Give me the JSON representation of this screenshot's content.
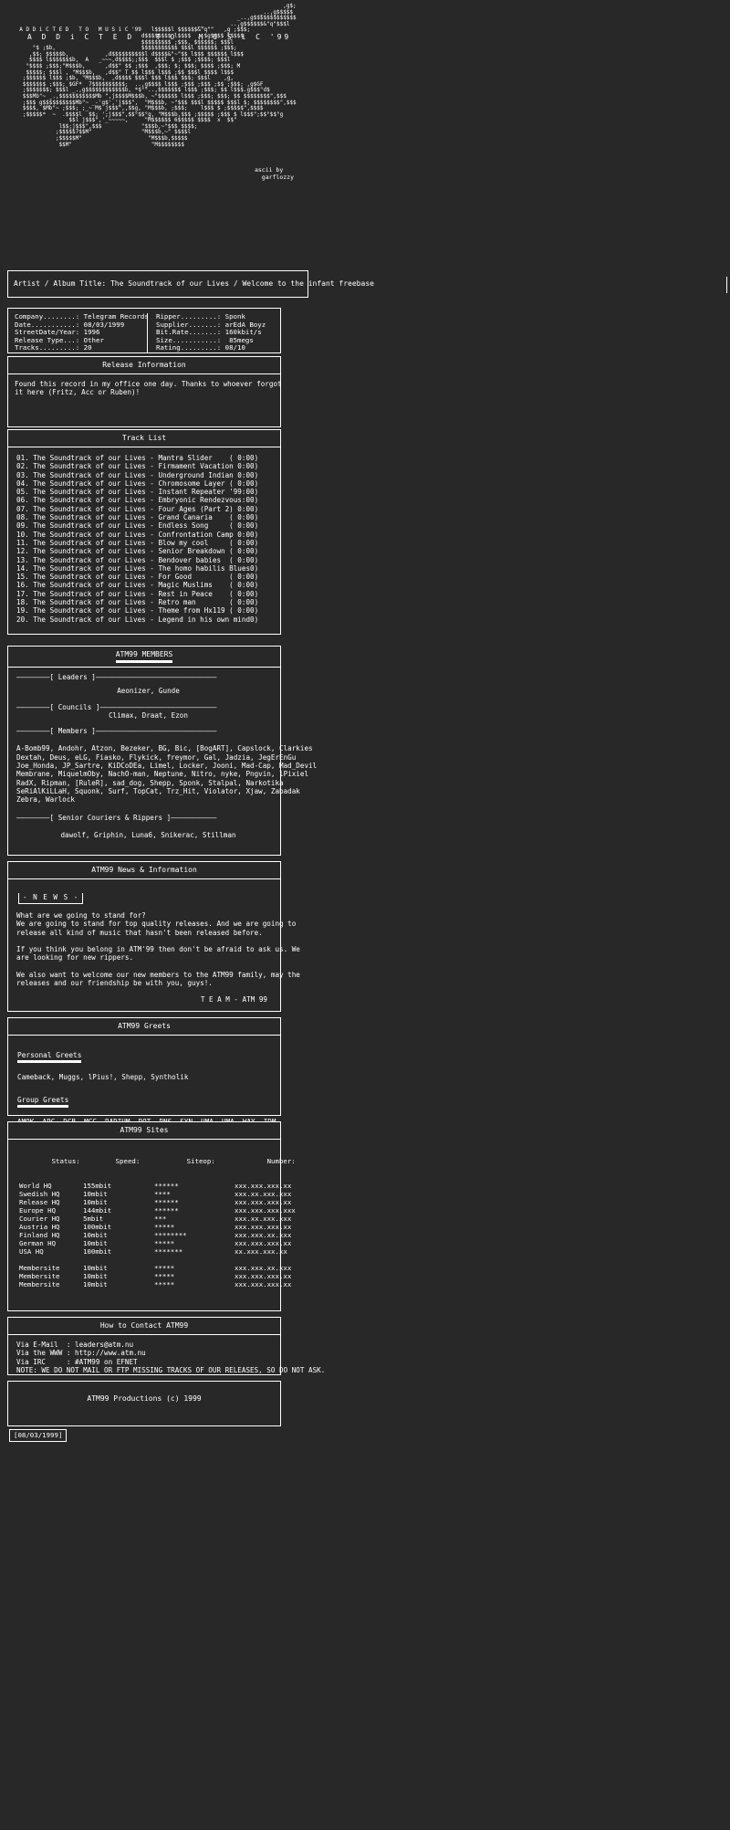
{
  "logo": {
    "ascii": "                                                                                  ,g$;\n                                                                           _..,g$$$$$\n                                                                    _..,g$$$$$$$$$$$$$\n                                                        __        ..,g$$$$$$&\"q\"$$$l\n  A D D i C T E D   T O   M U S i C '99   l$$$$$l $$$$$$&\"q\"\"   ,g ;$$$;\n                                       d$$$$$$$$ l$$$$  ,,$g$$$$ l$$$$\n                                       $$$$$$$$$ ;$$$, $$$$$$; $$$l\n      °$ ;$b,                          $$$$$$$$$$$ $$$l $$$$$$ ;$$$;\n     ,$$; $$$$$b,           ,d$$$$$$$$$$l d$$$$&\"~\"$$ l$$$ $$$$$$ l$$$\n     $$$$ l$$$$$$$b,  A   _~~~,d$$$$;;$$$  $$$l $ ;$$$ ;$$$$; $$$l\n    °$$$$ ;$$$;\"M$$$b,      ,d$$\" $$ ;$$$  ,$$$; $; $$$; $$$$ ;$$$; M\n    $$$$$; $$$l , \"M$$$b,   ,d$$\" T $$ l$$$ l$$$ ;$$ $$$l $$$$ l$$$\n   ;$$$$$$ l$$$ ;$b, \"M$$$b,  ,d$$$$ $$$l $$$ l$$$ $$$; $$$l    ,g,\n   $$$$$$$ ;$$$; $GF*  7$$$$$$$$$$;  ..,g$$$$ l$$$ ;$$$ ;$$$ ;$$ ;$$$; ,g$GF\n   ;$$$$$$$; $$$l _.,g$$$$$$$$$$$$b, *$°°..,$$$$$$$ l$$$ ;$$$; $$ l$$$.g$$$\"d$\n   $$$Mb\"~ _.,$$$$$$$$$$$Mb \",j$$$$M$$$b, ~\"$$$$$$ l$$$ ;$$$; $$$; $$ $$$$$$$$\",$$$\n   ;$$$ g$$$$$$$$$$Mb\"~ _-'g$','j$$$\",  \"M$$$b, ~\"$$$ $$$l $$$$$ $$$l $; $$$$$$$$\",$$$\n   $$$$, $Mb\"~ ;$$$; ;_~ M$ j$$$\",,$$g, \"M$$$b, ;$$$;    l$$$ $ ;$$$$$\",$$$$\n   ;$$$$$*  ~  .$$$$l  $$; ';j$$$\",$$°$$°g, \"M$$$b,$$$ ;$$$$$ ;$$$ $ l$$$\";$$°$$°g\n                 $$l j$$$\",'_~~~~~,     \"M$$$$$$ 6$$$$$ $$$$  x  $$\"\n              l$$;j$$$\",$$$            \"$$$b,~\"$$$ $$$$;\n             ;$$$$$7$$M\"               \"M$$$b,~\" $$$$l\n             ;$$$$$M\"                    \"M$$$b,$$$$$\n              $$M\"                        \"M$$$$$$$$",
    "title": "A D D i C T E D   T O   M U S i C '99",
    "credit": "ascii by\n  garflozzy"
  },
  "titlebar": {
    "text": "Artist / Album Title: The Soundtrack of our Lives / Welcome to the infant freebase"
  },
  "info": {
    "left": [
      "Company........: Telegram Records",
      "Date...........: 08/03/1999",
      "StreetDate/Year: 1996",
      "Release Type...: Other",
      "Tracks.........: 20"
    ],
    "right": [
      "Ripper.........: Sponk",
      "Supplier.......: arEdA Boyz",
      "Bit.Rate.......: 160kbit/s",
      "Size...........:  85megs",
      "Rating.........: 08/10"
    ]
  },
  "release_information": {
    "header": "Release Information",
    "body": "Found this record in my office one day. Thanks to whoever forgot\nit here (Fritz, Acc or Ruben)!"
  },
  "track_list": {
    "header": "Track List",
    "tracks": [
      "01. The Soundtrack of our Lives - Mantra Slider    ( 0:00)",
      "02. The Soundtrack of our Lives - Firmament Vacation 0:00)",
      "03. The Soundtrack of our Lives - Underground Indian 0:00)",
      "04. The Soundtrack of our Lives - Chromosome Layer ( 0:00)",
      "05. The Soundtrack of our Lives - Instant Repeater '99:00)",
      "06. The Soundtrack of our Lives - Embryonic Rendezvous:00)",
      "07. The Soundtrack of our Lives - Four Ages (Part 2) 0:00)",
      "08. The Soundtrack of our Lives - Grand Canaria    ( 0:00)",
      "09. The Soundtrack of our Lives - Endless Song     ( 0:00)",
      "10. The Soundtrack of our Lives - Confrontation Camp 0:00)",
      "11. The Soundtrack of our Lives - Blow my cool     ( 0:00)",
      "12. The Soundtrack of our Lives - Senior Breakdown ( 0:00)",
      "13. The Soundtrack of our Lives - Bendover babies  ( 0:00)",
      "14. The Soundtrack of our Lives - The homo habilis Blues0)",
      "15. The Soundtrack of our Lives - For Good         ( 0:00)",
      "16. The Soundtrack of our Lives - Magic Muslims    ( 0:00)",
      "17. The Soundtrack of our Lives - Rest in Peace    ( 0:00)",
      "18. The Soundtrack of our Lives - Retro man        ( 0:00)",
      "19. The Soundtrack of our Lives - Theme from Hx119 ( 0:00)",
      "20. The Soundtrack of our Lives - Legend in his own mind0)"
    ]
  },
  "members": {
    "header": "ATM99  MEMBERS",
    "leaders_rule": "————————[ Leaders ]—————————————————————————————",
    "leaders": "Aeonizer, Gunde",
    "councils_rule": "————————[ Councils ]————————————————————————————",
    "councils": "Climax, Draat, Ezon",
    "members_rule": "————————[ Members ]—————————————————————————————",
    "members_lines": [
      "A-Bomb99, Andohr, Atzon, Bezeker, BG, Bic, [BogART], Capslock, Clarkies",
      "Dextah, Deus, eLG, Fiasko, Flykick, freymor, Gal, Jadzia, JegErEnGu",
      "Joe_Honda, JP_Sartre, KiDCoDEa, Limel, Locker, Jooni, Mad-Cap, Mad_Devil",
      "Membrane, MiquelmOby, NachO-man, Neptune, Nitro, nyke, Pngvin, lPixiel",
      "RadX, Ripman, [RuleR], sad_dog, Shepp, Sponk, Stalpal, Narkotika",
      "SeRiAlKiLLaH, Squonk, Surf, TopCat, Trz_Hit, Violator, Xjaw, Zabadak",
      "Zebra, Warlock"
    ],
    "couriers_rule": "————————[ Senior Couriers & Rippers ]———————————",
    "couriers": "dawolf, Griphin, Luna6, Snikerac, Stillman"
  },
  "news": {
    "header": "ATM99 News & Information",
    "badge": "- N E W S -",
    "body": "What are we going to stand for?\nWe are going to stand for top quality releases. And we are going to\nrelease all kind of music that hasn't been released before.\n\nIf you think you belong in ATM'99 then don't be afraid to ask us. We\nare looking for new rippers.\n\nWe also want to welcome our new members to the ATM99 family, may the\nreleases and our friendship be with you, guys!.",
    "signature": "T E A M - ATM 99"
  },
  "greets": {
    "header": "ATM99 Greets",
    "personal_label": "Personal Greets",
    "personal": "Cameback, Muggs, lPius!, Shepp, Syntholik",
    "group_label": "Group Greets",
    "group": "AMOK, APC, DCB, MGC, RADIUM, ROT, RNS, SYN, UMA, UMA, WAX, IDM\nand all the other groups who release QUALITY rips!"
  },
  "sites": {
    "header": "ATM99 Sites",
    "columns": [
      "Status:",
      "Speed:",
      "Siteop:",
      "Number:"
    ],
    "rows": [
      [
        "World HQ",
        "155mbit",
        "******",
        "xxx.xxx.xxx.xx"
      ],
      [
        "Swedish HQ",
        "10mbit",
        "****",
        "xxx.xx.xxx.xxx"
      ],
      [
        "Release HQ",
        "10mbit",
        "******",
        "xxx.xxx.xxx.xx"
      ],
      [
        "Europe HQ",
        "144mbit",
        "******",
        "xxx.xxx.xxx.xxx"
      ],
      [
        "Courier HQ",
        "5mbit",
        "***",
        "xxx.xx.xxx.xxx"
      ],
      [
        "Austria HQ",
        "100mbit",
        "*****",
        "xxx.xxx.xxx.xx"
      ],
      [
        "Finland HQ",
        "10mbit",
        "********",
        "xxx.xxx.xx.xxx"
      ],
      [
        "German HQ",
        "10mbit",
        "*****",
        "xxx.xxx.xxx.xx"
      ],
      [
        "USA HQ",
        "100mbit",
        "*******",
        "xx.xxx.xxx.xx"
      ]
    ],
    "member_rows": [
      [
        "Membersite",
        "10mbit",
        "*****",
        "xxx.xxx.xx.xxx"
      ],
      [
        "Membersite",
        "10mbit",
        "*****",
        "xxx.xxx.xxx.xx"
      ],
      [
        "Membersite",
        "10mbit",
        "*****",
        "xxx.xxx.xxx.xx"
      ]
    ]
  },
  "contact": {
    "header": "How to Contact ATM99",
    "lines": [
      "Via E-Mail  : leaders@atm.nu",
      "Via the WWW : http://www.atm.nu",
      "Via IRC     : #ATM99 on EFNET",
      "NOTE: WE DO NOT MAIL OR FTP MISSING TRACKS OF OUR RELEASES, SO DO NOT ASK."
    ]
  },
  "footer": {
    "text": "ATM99 Productions (c) 1999",
    "datestamp": "[08/03/1999]"
  }
}
